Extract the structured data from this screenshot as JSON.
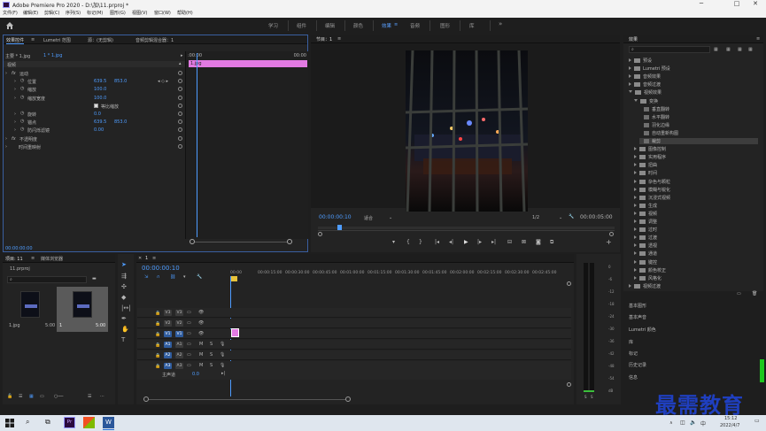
{
  "window": {
    "title": "Adobe Premiere Pro 2020 - D:\\加\\11.prproj *",
    "minimize": "─",
    "maximize": "□",
    "close": "✕"
  },
  "menu": [
    "文件(F)",
    "编辑(E)",
    "剪辑(C)",
    "序列(S)",
    "标记(M)",
    "图形(G)",
    "视图(V)",
    "窗口(W)",
    "帮助(H)"
  ],
  "workspaces": {
    "tabs": [
      "学习",
      "组件",
      "编辑",
      "颜色",
      "效果",
      "音频",
      "图形",
      "库"
    ],
    "active_index": 4,
    "more": "»"
  },
  "effect_controls": {
    "tabs": [
      "效果控件",
      "Lumetri 范围",
      "源：(无剪辑)",
      "音频剪辑混合器：1"
    ],
    "menu_icon": "≡",
    "clip_path": "主要 * 1.jpg",
    "clip_link": "1 * 1.jpg",
    "timecode_start": ":00:00",
    "timecode_end": "00:00",
    "clip_label": "1.jpg",
    "section_video": "视频",
    "properties": [
      {
        "name": "运动",
        "value1": "",
        "value2": "",
        "level": 0,
        "fx": true
      },
      {
        "name": "位置",
        "value1": "639.5",
        "value2": "853.0",
        "level": 1
      },
      {
        "name": "缩放",
        "value1": "100.0",
        "value2": "",
        "level": 1
      },
      {
        "name": "缩放宽度",
        "value1": "100.0",
        "value2": "",
        "level": 1
      },
      {
        "name": "等比缩放",
        "value1": "",
        "value2": "",
        "level": 1,
        "checkbox": true
      },
      {
        "name": "旋转",
        "value1": "0.0",
        "value2": "",
        "level": 1
      },
      {
        "name": "锚点",
        "value1": "639.5",
        "value2": "853.0",
        "level": 1
      },
      {
        "name": "防闪烁滤镜",
        "value1": "0.00",
        "value2": "",
        "level": 1
      },
      {
        "name": "不透明度",
        "value1": "",
        "value2": "",
        "level": 0,
        "fx": true
      },
      {
        "name": "时间重映射",
        "value1": "",
        "value2": "",
        "level": 0
      }
    ],
    "footer_timecode": "00:00:00:00"
  },
  "program_monitor": {
    "title": "节目：1",
    "menu_icon": "≡",
    "timecode": "00:00:00:10",
    "fit": "适合",
    "quality": "1/2",
    "duration": "00:00:05:00",
    "add_button": "+"
  },
  "effects_panel": {
    "title": "效果",
    "menu_icon": "≡",
    "search_placeholder": "",
    "tree": [
      {
        "label": "预设",
        "level": 0,
        "open": false
      },
      {
        "label": "Lumetri 预设",
        "level": 0,
        "open": false
      },
      {
        "label": "音频效果",
        "level": 0,
        "open": false
      },
      {
        "label": "音频过渡",
        "level": 0,
        "open": false
      },
      {
        "label": "视频效果",
        "level": 0,
        "open": true
      },
      {
        "label": "变换",
        "level": 1,
        "open": true
      },
      {
        "label": "垂直翻转",
        "level": 2,
        "item": true
      },
      {
        "label": "水平翻转",
        "level": 2,
        "item": true
      },
      {
        "label": "羽化边缘",
        "level": 2,
        "item": true
      },
      {
        "label": "自动重新构图",
        "level": 2,
        "item": true
      },
      {
        "label": "裁剪",
        "level": 2,
        "item": true,
        "selected": true
      },
      {
        "label": "图像控制",
        "level": 1
      },
      {
        "label": "实用程序",
        "level": 1
      },
      {
        "label": "扭曲",
        "level": 1
      },
      {
        "label": "时间",
        "level": 1
      },
      {
        "label": "杂色与颗粒",
        "level": 1
      },
      {
        "label": "模糊与锐化",
        "level": 1
      },
      {
        "label": "沉浸式视频",
        "level": 1
      },
      {
        "label": "生成",
        "level": 1
      },
      {
        "label": "视频",
        "level": 1
      },
      {
        "label": "调整",
        "level": 1
      },
      {
        "label": "过时",
        "level": 1
      },
      {
        "label": "过渡",
        "level": 1
      },
      {
        "label": "透视",
        "level": 1
      },
      {
        "label": "通道",
        "level": 1
      },
      {
        "label": "键控",
        "level": 1
      },
      {
        "label": "颜色校正",
        "level": 1
      },
      {
        "label": "风格化",
        "level": 1
      },
      {
        "label": "视频过渡",
        "level": 0,
        "open": false
      }
    ],
    "side_panels": [
      "基本图形",
      "基本声音",
      "Lumetri 颜色",
      "库",
      "标记",
      "历史记录",
      "信息"
    ]
  },
  "project_panel": {
    "tabs": [
      "项目: 11",
      "媒体浏览器"
    ],
    "menu_icon": "≡",
    "project_file": "11.prproj",
    "search_placeholder": "",
    "items": [
      {
        "name": "1.jpg",
        "duration": "5:00"
      },
      {
        "name": "1",
        "duration": "5:00"
      }
    ]
  },
  "timeline": {
    "tab": "1",
    "close": "✕",
    "menu_icon": "≡",
    "timecode": "00:00:00:10",
    "ruler": [
      "00:00",
      "00:00:15:00",
      "00:00:30:00",
      "00:00:45:00",
      "00:01:00:00",
      "00:01:15:00",
      "00:01:30:00",
      "00:01:45:00",
      "00:02:00:00",
      "00:02:15:00",
      "00:02:30:00",
      "00:02:45:00"
    ],
    "tracks": [
      {
        "id": "V3",
        "type": "video"
      },
      {
        "id": "V2",
        "type": "video"
      },
      {
        "id": "V1",
        "type": "video",
        "active": true
      },
      {
        "id": "A1",
        "type": "audio",
        "active": true
      },
      {
        "id": "A2",
        "type": "audio",
        "active": true
      },
      {
        "id": "A3",
        "type": "audio",
        "active": true
      }
    ],
    "mute": "M",
    "solo": "S",
    "master_label": "主声道",
    "master_value": "0.0"
  },
  "audio_meter": {
    "scale": [
      "0",
      "-6",
      "-12",
      "-18",
      "-24",
      "-30",
      "-36",
      "-42",
      "-48",
      "-54",
      "dB"
    ],
    "solo_left": "S",
    "solo_right": "S"
  },
  "watermark": "最需教育",
  "taskbar": {
    "time": "15:12",
    "date": "2022/4/7",
    "ime": "中",
    "ai_label": "Ai"
  },
  "colors": {
    "accent": "#4e9cff",
    "clip_pink": "#e27ae2",
    "selection": "#3d3d3d",
    "playhead": "#4e9cff"
  }
}
